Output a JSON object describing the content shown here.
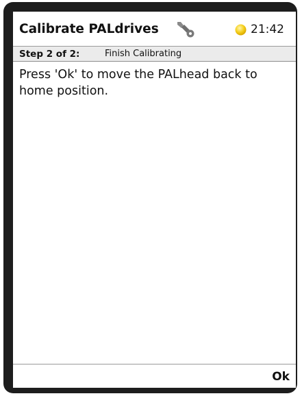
{
  "header": {
    "title": "Calibrate PALdrives",
    "wrench_icon": "wrench-icon",
    "status_icon": "status-indicator-icon",
    "status_color": "#f3c200",
    "time": "21:42"
  },
  "step": {
    "number": "Step 2 of 2:",
    "name": "Finish Calibrating"
  },
  "content": {
    "message": "Press 'Ok' to move the PALhead back to home position."
  },
  "softkeys": {
    "ok_label": "Ok"
  }
}
